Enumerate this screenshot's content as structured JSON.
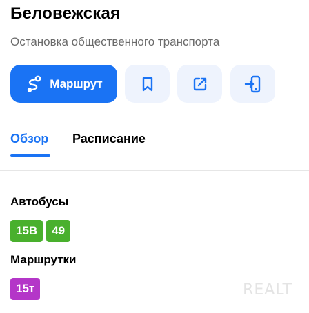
{
  "place": {
    "title": "Беловежская",
    "subtitle": "Остановка общественного транспорта"
  },
  "actions": {
    "route_label": "Маршрут",
    "route_icon": "route-icon",
    "bookmark_icon": "bookmark-icon",
    "share_icon": "share-icon",
    "send_to_phone_icon": "send-to-phone-icon"
  },
  "tabs": [
    {
      "label": "Обзор",
      "active": true
    },
    {
      "label": "Расписание",
      "active": false
    }
  ],
  "transport": [
    {
      "title": "Автобусы",
      "routes": [
        {
          "number": "15В",
          "color": "#49b02d"
        },
        {
          "number": "49",
          "color": "#49b02d"
        }
      ]
    },
    {
      "title": "Маршрутки",
      "routes": [
        {
          "number": "15т",
          "color": "#b436c8"
        }
      ]
    }
  ],
  "watermark": "REALT",
  "colors": {
    "accent": "#1a73f4",
    "icon_button_bg": "#eef3fd",
    "bus": "#49b02d",
    "minibus": "#b436c8"
  }
}
